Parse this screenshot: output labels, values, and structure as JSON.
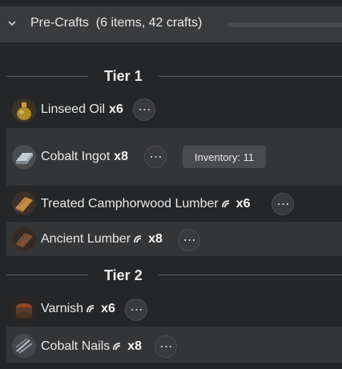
{
  "header": {
    "title": "Pre-Crafts",
    "summary": "(6 items, 42 crafts)"
  },
  "tiers": [
    {
      "label": "Tier 1",
      "items": [
        {
          "name": "Linseed Oil",
          "qty": "x6",
          "icon": "oil-flask-icon",
          "icon_color": "#b08a2a"
        },
        {
          "name": "Cobalt Ingot",
          "qty": "x8",
          "icon": "ingot-icon",
          "icon_color": "#9aa3ad",
          "inventory": "Inventory: 11"
        },
        {
          "name": "Treated Camphorwood Lumber",
          "qty": "x6",
          "icon": "lumber-icon",
          "icon_color": "#b07a3c"
        },
        {
          "name": "Ancient Lumber",
          "qty": "x8",
          "icon": "lumber-icon",
          "icon_color": "#6d4a2e"
        }
      ]
    },
    {
      "label": "Tier 2",
      "items": [
        {
          "name": "Varnish",
          "qty": "x6",
          "icon": "varnish-jar-icon",
          "icon_color": "#8a3a2a"
        },
        {
          "name": "Cobalt Nails",
          "qty": "x8",
          "icon": "nails-icon",
          "icon_color": "#8f959c"
        }
      ]
    }
  ],
  "more_glyph": "⋯",
  "colors": {
    "background": "#242628",
    "header": "#3a3b3d",
    "row_highlight": "#343537"
  }
}
